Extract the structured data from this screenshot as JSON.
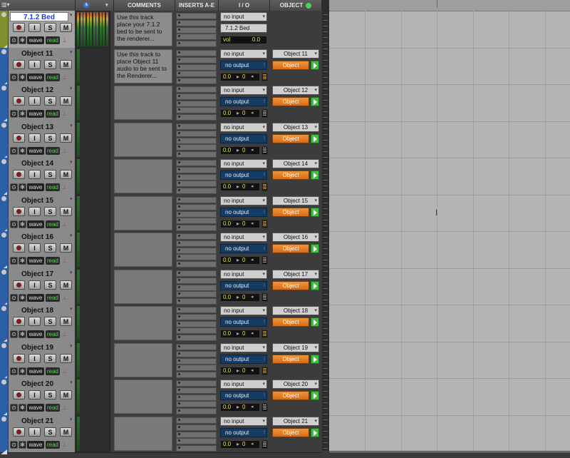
{
  "header": {
    "comments_label": "COMMENTS",
    "inserts_label": "INSERTS A-E",
    "io_label": "I / O",
    "object_label": "OBJECT"
  },
  "colors": {
    "object_button": "#e8842a",
    "play_green": "#3fbf3f",
    "output_blue": "#143b63",
    "track_blue": "#2c5fa8",
    "bed_strip": "#7e8f2c"
  },
  "tracks": [
    {
      "name": "7.1.2 Bed",
      "bed": true,
      "comment": "Use this track place your 7.1.2 bed to be sent to the renderer...",
      "input": "no input",
      "output": "7.1.2 Bed",
      "vol_label": "vol",
      "vol_value": "0.0",
      "rec": "",
      "i": "I",
      "s": "S",
      "m": "M",
      "wave": "wave",
      "read": "read"
    },
    {
      "name": "Object 11",
      "bed": false,
      "comment": "Use this track to place Object 11 audio to be sent to the Renderer...",
      "input": "no input",
      "output": "no output",
      "vol_a": "0.0",
      "vol_b": "0",
      "object_name": "Object 11",
      "object_btn": "Object",
      "i": "I",
      "s": "S",
      "m": "M",
      "wave": "wave",
      "read": "read"
    },
    {
      "name": "Object 12",
      "bed": false,
      "comment": "",
      "input": "no input",
      "output": "no output",
      "vol_a": "0.0",
      "vol_b": "0",
      "object_name": "Object 12",
      "object_btn": "Object",
      "i": "I",
      "s": "S",
      "m": "M",
      "wave": "wave",
      "read": "read"
    },
    {
      "name": "Object 13",
      "bed": false,
      "comment": "",
      "input": "no input",
      "output": "no output",
      "vol_a": "0.0",
      "vol_b": "0",
      "object_name": "Object 13",
      "object_btn": "Object",
      "i": "I",
      "s": "S",
      "m": "M",
      "wave": "wave",
      "read": "read"
    },
    {
      "name": "Object 14",
      "bed": false,
      "comment": "",
      "input": "no input",
      "output": "no output",
      "vol_a": "0.0",
      "vol_b": "0",
      "object_name": "Object 14",
      "object_btn": "Object",
      "i": "I",
      "s": "S",
      "m": "M",
      "wave": "wave",
      "read": "read"
    },
    {
      "name": "Object 15",
      "bed": false,
      "comment": "",
      "input": "no input",
      "output": "no output",
      "vol_a": "0.0",
      "vol_b": "0",
      "object_name": "Object 15",
      "object_btn": "Object",
      "i": "I",
      "s": "S",
      "m": "M",
      "wave": "wave",
      "read": "read"
    },
    {
      "name": "Object 16",
      "bed": false,
      "comment": "",
      "input": "no input",
      "output": "no output",
      "vol_a": "0.0",
      "vol_b": "0",
      "object_name": "Object 16",
      "object_btn": "Object",
      "i": "I",
      "s": "S",
      "m": "M",
      "wave": "wave",
      "read": "read"
    },
    {
      "name": "Object 17",
      "bed": false,
      "comment": "",
      "input": "no input",
      "output": "no output",
      "vol_a": "0.0",
      "vol_b": "0",
      "object_name": "Object 17",
      "object_btn": "Object",
      "i": "I",
      "s": "S",
      "m": "M",
      "wave": "wave",
      "read": "read"
    },
    {
      "name": "Object 18",
      "bed": false,
      "comment": "",
      "input": "no input",
      "output": "no output",
      "vol_a": "0.0",
      "vol_b": "0",
      "object_name": "Object 18",
      "object_btn": "Object",
      "i": "I",
      "s": "S",
      "m": "M",
      "wave": "wave",
      "read": "read"
    },
    {
      "name": "Object 19",
      "bed": false,
      "comment": "",
      "input": "no input",
      "output": "no output",
      "vol_a": "0.0",
      "vol_b": "0",
      "object_name": "Object 19",
      "object_btn": "Object",
      "i": "I",
      "s": "S",
      "m": "M",
      "wave": "wave",
      "read": "read"
    },
    {
      "name": "Object 20",
      "bed": false,
      "comment": "",
      "input": "no input",
      "output": "no output",
      "vol_a": "0.0",
      "vol_b": "0",
      "object_name": "Object 20",
      "object_btn": "Object",
      "i": "I",
      "s": "S",
      "m": "M",
      "wave": "wave",
      "read": "read"
    },
    {
      "name": "Object 21",
      "bed": false,
      "comment": "",
      "input": "no input",
      "output": "no output",
      "vol_a": "0.0",
      "vol_b": "0",
      "object_name": "Object 21",
      "object_btn": "Object",
      "i": "I",
      "s": "S",
      "m": "M",
      "wave": "wave",
      "read": "read"
    }
  ]
}
